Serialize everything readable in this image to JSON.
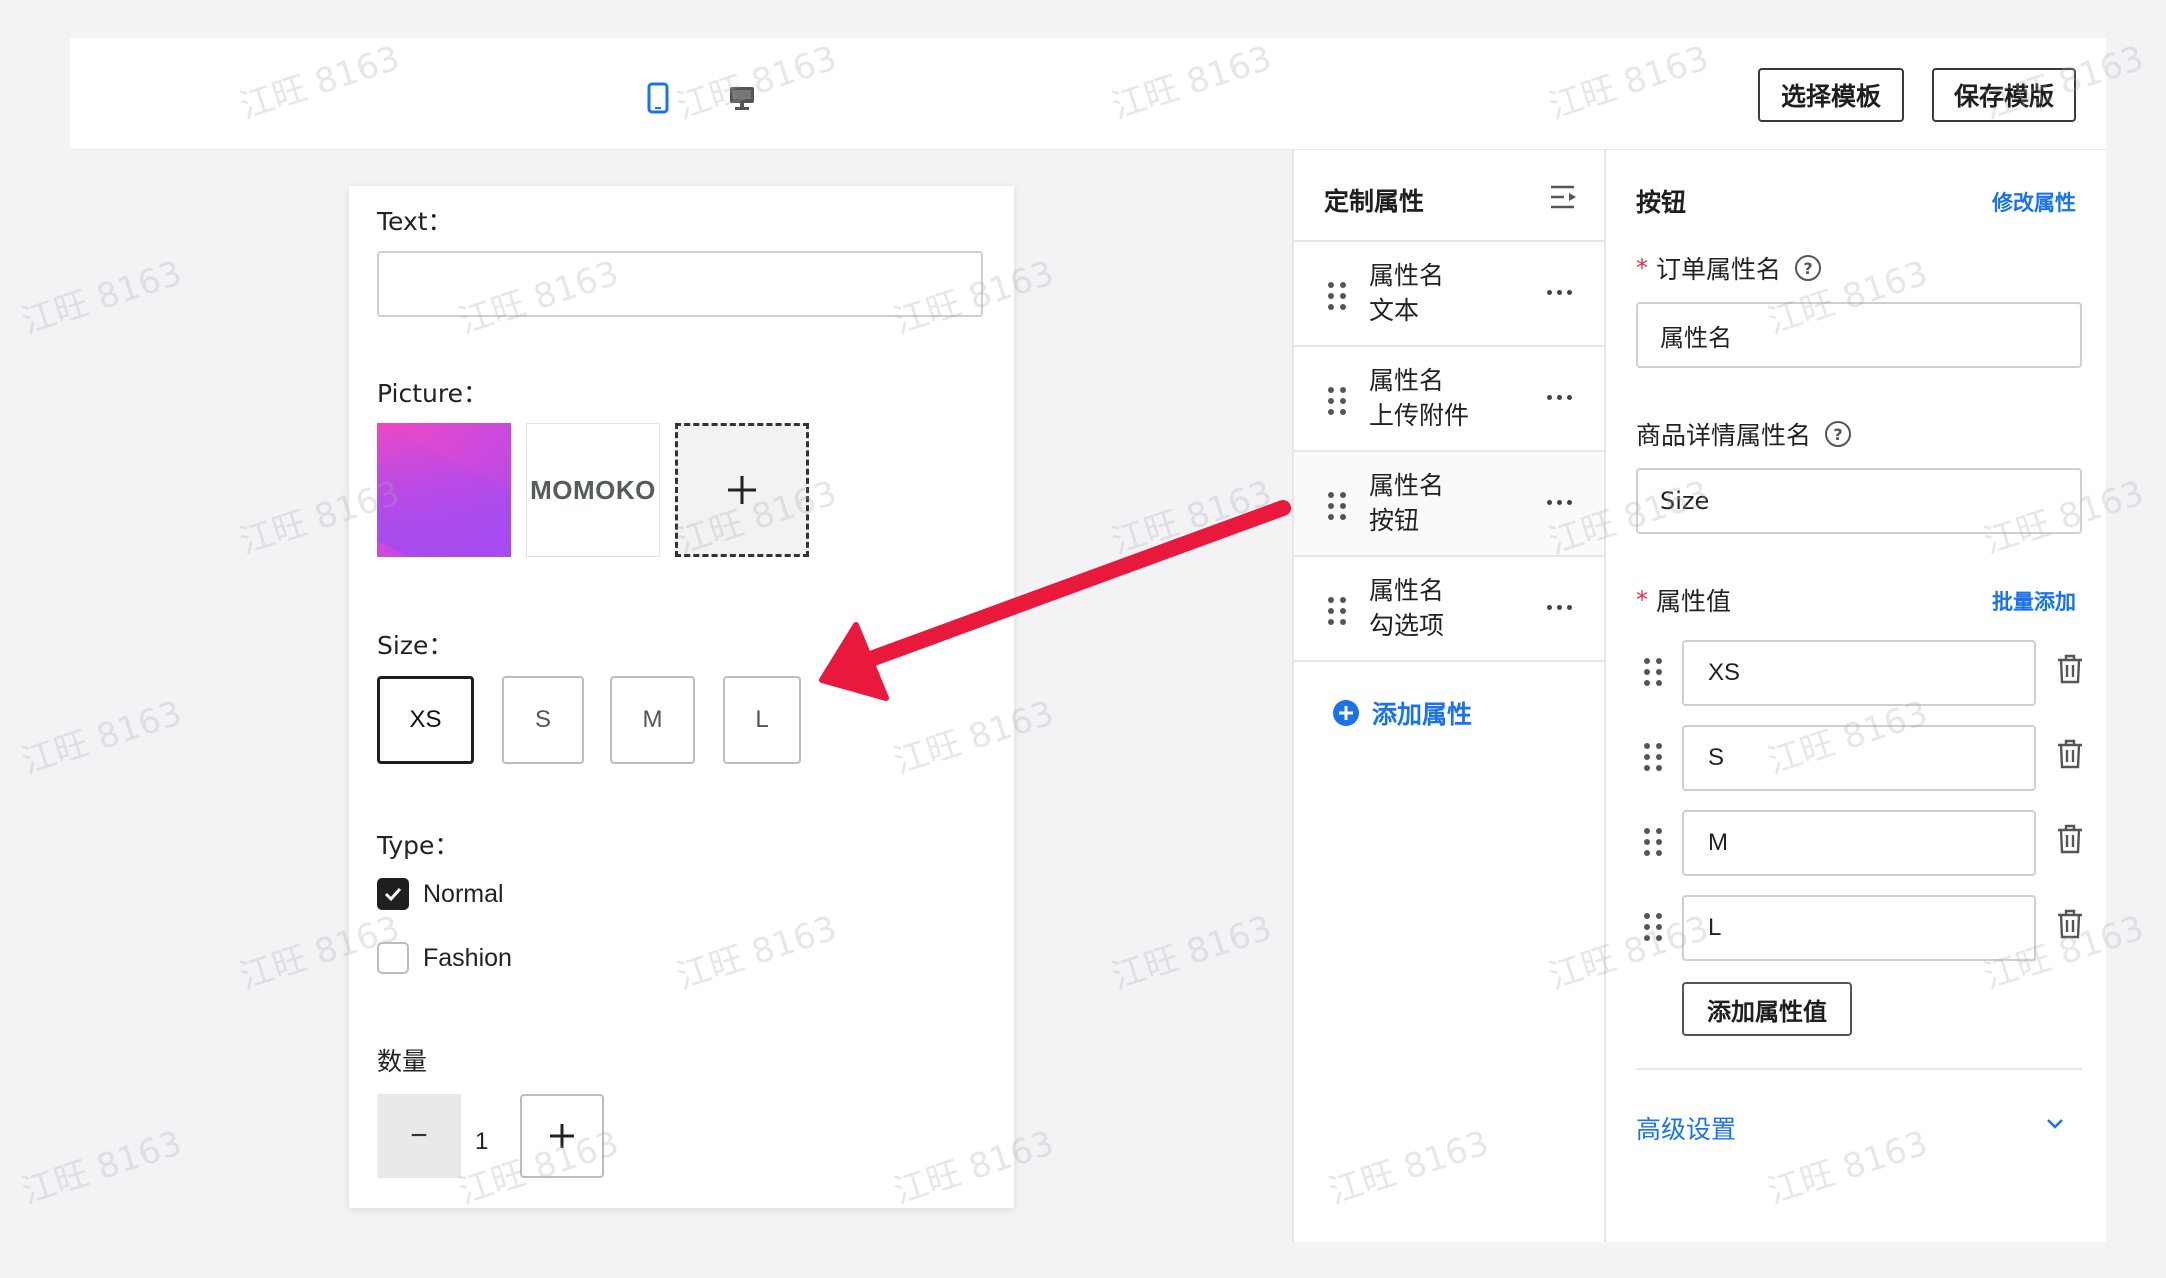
{
  "toolbar": {
    "mobile_icon": "mobile-device-icon",
    "desktop_icon": "desktop-monitor-icon",
    "select_template": "选择模板",
    "save_template": "保存模版"
  },
  "preview": {
    "text_label": "Text：",
    "text_value": "",
    "picture_label": "Picture：",
    "pictures": [
      {
        "kind": "gradient-image"
      },
      {
        "kind": "logo",
        "text": "MOMOKO"
      },
      {
        "kind": "add",
        "icon": "plus-icon"
      }
    ],
    "size_label": "Size：",
    "sizes": [
      "XS",
      "S",
      "M",
      "L"
    ],
    "selected_size": "XS",
    "type_label": "Type：",
    "types": [
      {
        "label": "Normal",
        "checked": true
      },
      {
        "label": "Fashion",
        "checked": false
      }
    ],
    "quantity_label": "数量",
    "quantity_value": "1",
    "minus": "−",
    "plus": "+"
  },
  "custom_attrs": {
    "title": "定制属性",
    "items": [
      {
        "name": "属性名",
        "type": "文本"
      },
      {
        "name": "属性名",
        "type": "上传附件"
      },
      {
        "name": "属性名",
        "type": "按钮"
      },
      {
        "name": "属性名",
        "type": "勾选项"
      }
    ],
    "add_label": "添加属性"
  },
  "config": {
    "title": "按钮",
    "edit_link": "修改属性",
    "order_attr_label": "订单属性名",
    "order_attr_value": "属性名",
    "detail_attr_label": "商品详情属性名",
    "detail_attr_value": "Size",
    "values_label": "属性值",
    "batch_add": "批量添加",
    "values": [
      "XS",
      "S",
      "M",
      "L"
    ],
    "add_value": "添加属性值",
    "advanced": "高级设置",
    "help_glyph": "?"
  },
  "colors": {
    "accent": "#1a73e8",
    "required": "#e0324b",
    "arrow": "#e8193c"
  },
  "watermark": "江旺 8163"
}
